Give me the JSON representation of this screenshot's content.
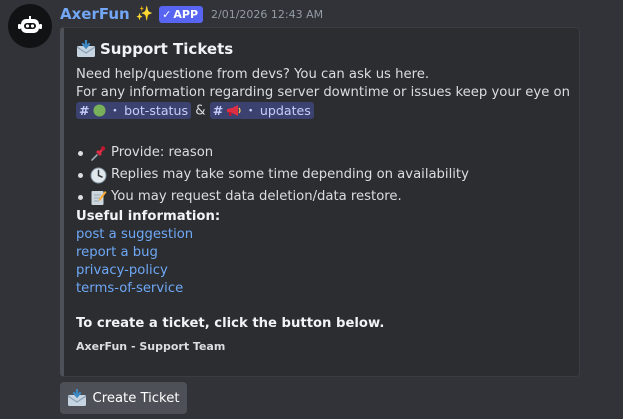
{
  "author": {
    "name": "AxerFun",
    "sparkle": "✨",
    "badge_check": "✓",
    "badge_label": "APP",
    "timestamp": "2/01/2026 12:43 AM",
    "avatar_icon": "robot-icon"
  },
  "embed": {
    "title": "Support Tickets",
    "title_icon": "envelope-arrow-icon",
    "description_line1": "Need help/questione from devs? You can ask us here.",
    "description_line2": "For any information regarding server downtime or issues keep your eye on",
    "channels": [
      {
        "hash": "#",
        "emoji_icon": "green-circle-icon",
        "sep": "・",
        "name": "bot-status"
      },
      {
        "hash": "#",
        "emoji_icon": "megaphone-icon",
        "sep": "・",
        "name": "updates"
      }
    ],
    "channel_joiner": "&",
    "bullets": [
      {
        "icon": "pushpin-icon",
        "text": "Provide: reason"
      },
      {
        "icon": "clock-icon",
        "text": "Replies may take some time depending on availability"
      },
      {
        "icon": "memo-icon",
        "text": "You may request data deletion/data restore."
      }
    ],
    "useful_title": "Useful information:",
    "links": [
      "post a suggestion",
      "report a bug",
      "privacy-policy",
      "terms-of-service"
    ],
    "cta": "To create a ticket, click the button below.",
    "footer": "AxerFun - Support Team",
    "colors": {
      "embed_bg": "#2b2d31",
      "accent_bar": "#4e5058",
      "link": "#6fa8f6",
      "mention_bg": "#3c4270"
    }
  },
  "button": {
    "label": "Create Ticket",
    "icon": "envelope-arrow-icon"
  }
}
